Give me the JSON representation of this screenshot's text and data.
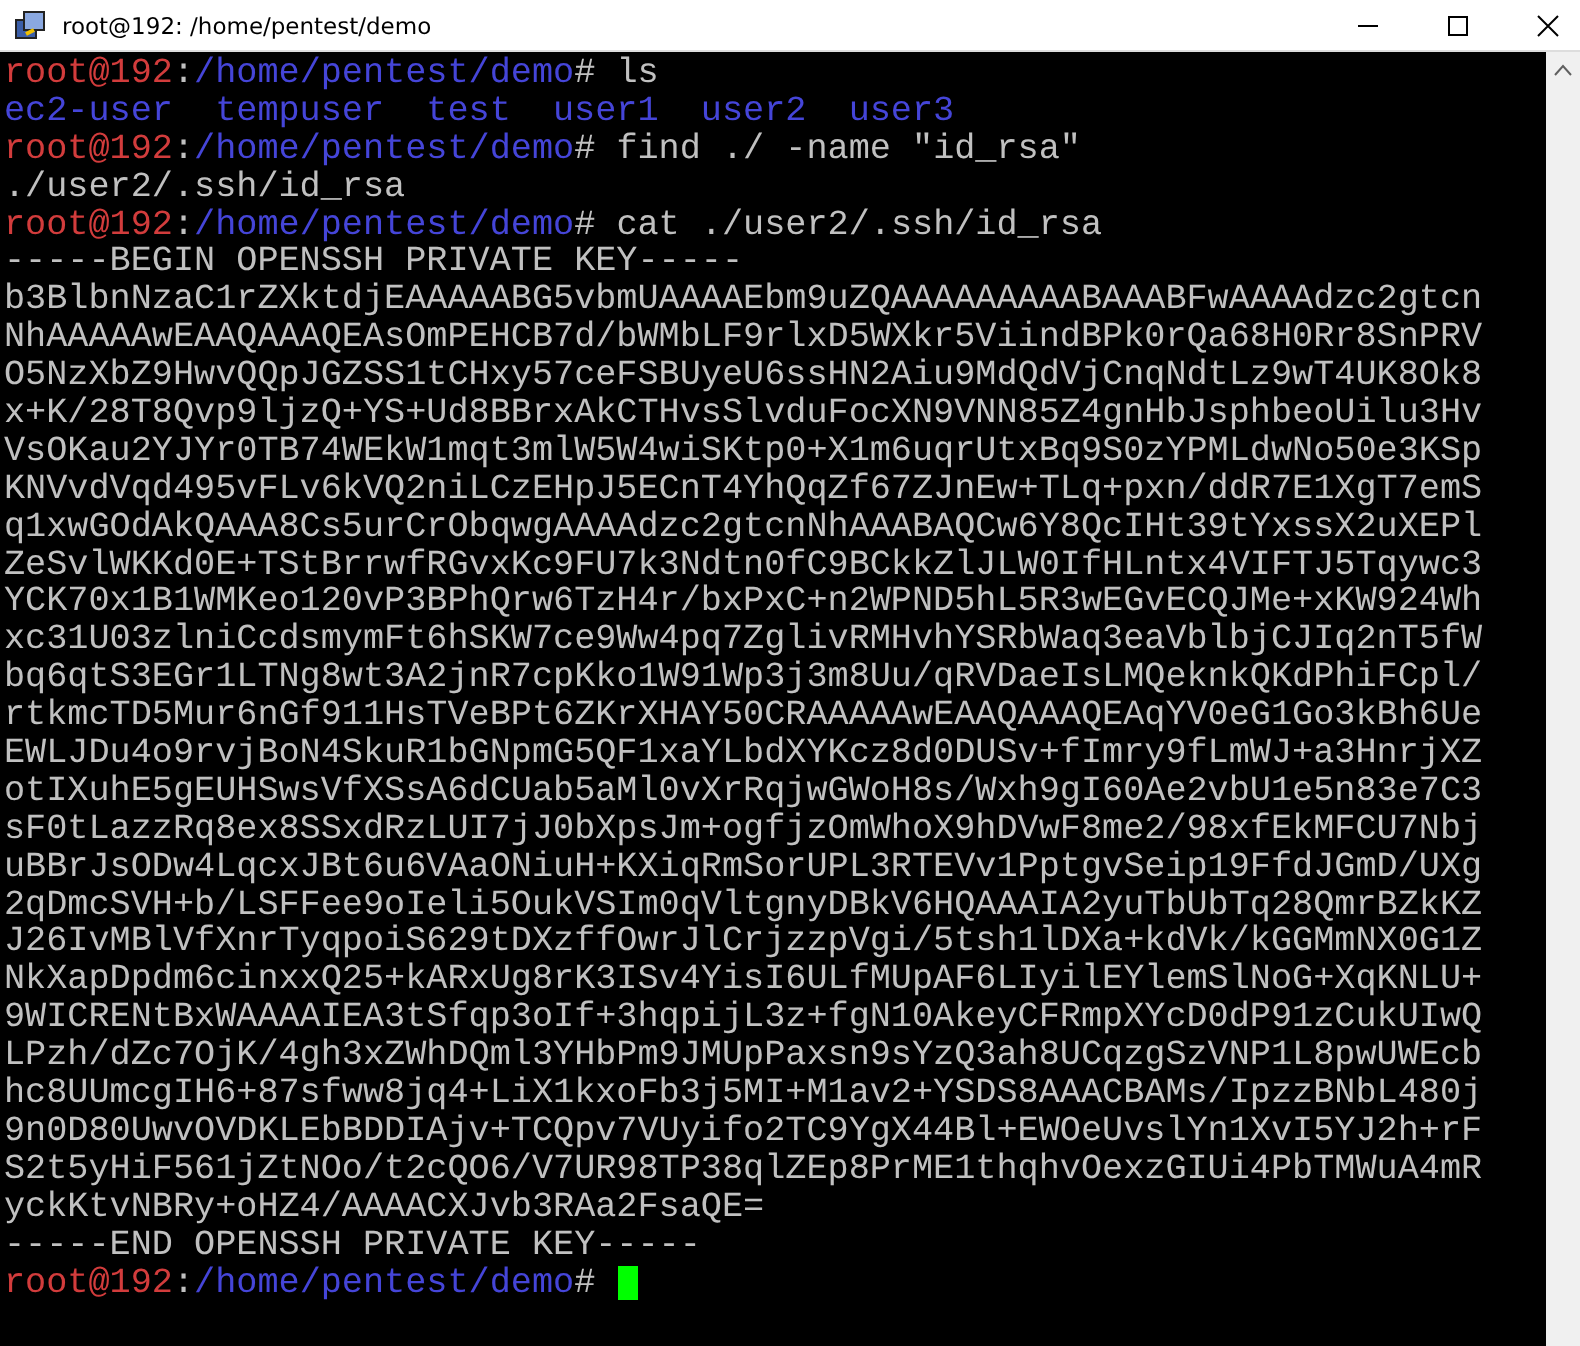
{
  "window": {
    "title": "root@192: /home/pentest/demo"
  },
  "terminal": {
    "lines": [
      {
        "kind": "prompt",
        "user": "root@192",
        "separator": ":",
        "path": "/home/pentest/demo",
        "command": "# ls",
        "cursor": false
      },
      {
        "kind": "listing",
        "items": [
          "ec2-user",
          "tempuser",
          "test",
          "user1",
          "user2",
          "user3"
        ]
      },
      {
        "kind": "prompt",
        "user": "root@192",
        "separator": ":",
        "path": "/home/pentest/demo",
        "command": "# find ./ -name \"id_rsa\"",
        "cursor": false
      },
      {
        "kind": "output",
        "text": "./user2/.ssh/id_rsa"
      },
      {
        "kind": "prompt",
        "user": "root@192",
        "separator": ":",
        "path": "/home/pentest/demo",
        "command": "# cat ./user2/.ssh/id_rsa",
        "cursor": false
      },
      {
        "kind": "output",
        "text": "-----BEGIN OPENSSH PRIVATE KEY-----"
      },
      {
        "kind": "output",
        "text": "b3BlbnNzaC1rZXktdjEAAAAABG5vbmUAAAAEbm9uZQAAAAAAAAABAAABFwAAAAdzc2gtcn"
      },
      {
        "kind": "output",
        "text": "NhAAAAAwEAAQAAAQEAsOmPEHCB7d/bWMbLF9rlxD5WXkr5ViindBPk0rQa68H0Rr8SnPRV"
      },
      {
        "kind": "output",
        "text": "O5NzXbZ9HwvQQpJGZSS1tCHxy57ceFSBUyeU6ssHN2Aiu9MdQdVjCnqNdtLz9wT4UK8Ok8"
      },
      {
        "kind": "output",
        "text": "x+K/28T8Qvp9ljzQ+YS+Ud8BBrxAkCTHvsSlvduFocXN9VNN85Z4gnHbJsphbeoUilu3Hv"
      },
      {
        "kind": "output",
        "text": "VsOKau2YJYr0TB74WEkW1mqt3mlW5W4wiSKtp0+X1m6uqrUtxBq9S0zYPMLdwNo50e3KSp"
      },
      {
        "kind": "output",
        "text": "KNVvdVqd495vFLv6kVQ2niLCzEHpJ5ECnT4YhQqZf67ZJnEw+TLq+pxn/ddR7E1XgT7emS"
      },
      {
        "kind": "output",
        "text": "q1xwGOdAkQAAA8Cs5urCrObqwgAAAAdzc2gtcnNhAAABAQCw6Y8QcIHt39tYxssX2uXEPl"
      },
      {
        "kind": "output",
        "text": "ZeSvlWKKd0E+TStBrrwfRGvxKc9FU7k3Ndtn0fC9BCkkZlJLW0IfHLntx4VIFTJ5Tqywc3"
      },
      {
        "kind": "output",
        "text": "YCK70x1B1WMKeo120vP3BPhQrw6TzH4r/bxPxC+n2WPND5hL5R3wEGvECQJMe+xKW924Wh"
      },
      {
        "kind": "output",
        "text": "xc31U03zlniCcdsmymFt6hSKW7ce9Ww4pq7ZglivRMHvhYSRbWaq3eaVblbjCJIq2nT5fW"
      },
      {
        "kind": "output",
        "text": "bq6qtS3EGr1LTNg8wt3A2jnR7cpKko1W91Wp3j3m8Uu/qRVDaeIsLMQeknkQKdPhiFCpl/"
      },
      {
        "kind": "output",
        "text": "rtkmcTD5Mur6nGf911HsTVeBPt6ZKrXHAY50CRAAAAAwEAAQAAAQEAqYV0eG1Go3kBh6Ue"
      },
      {
        "kind": "output",
        "text": "EWLJDu4o9rvjBoN4SkuR1bGNpmG5QF1xaYLbdXYKcz8d0DUSv+fImry9fLmWJ+a3HnrjXZ"
      },
      {
        "kind": "output",
        "text": "otIXuhE5gEUHSwsVfXSsA6dCUab5aMl0vXrRqjwGWoH8s/Wxh9gI60Ae2vbU1e5n83e7C3"
      },
      {
        "kind": "output",
        "text": "sF0tLazzRq8ex8SSxdRzLUI7jJ0bXpsJm+ogfjzOmWhoX9hDVwF8me2/98xfEkMFCU7Nbj"
      },
      {
        "kind": "output",
        "text": "uBBrJsODw4LqcxJBt6u6VAaONiuH+KXiqRmSorUPL3RTEVv1PptgvSeip19FfdJGmD/UXg"
      },
      {
        "kind": "output",
        "text": "2qDmcSVH+b/LSFFee9oIeli5OukVSIm0qVltgnyDBkV6HQAAAIA2yuTbUbTq28QmrBZkKZ"
      },
      {
        "kind": "output",
        "text": "J26IvMBlVfXnrTyqpoiS629tDXzffOwrJlCrjzzpVgi/5tsh1lDXa+kdVk/kGGMmNX0G1Z"
      },
      {
        "kind": "output",
        "text": "NkXapDpdm6cinxxQ25+kARxUg8rK3ISv4YisI6ULfMUpAF6LIyilEYlemSlNoG+XqKNLU+"
      },
      {
        "kind": "output",
        "text": "9WICRENtBxWAAAAIEA3tSfqp3oIf+3hqpijL3z+fgN10AkeyCFRmpXYcD0dP91zCukUIwQ"
      },
      {
        "kind": "output",
        "text": "LPzh/dZc7OjK/4gh3xZWhDQml3YHbPm9JMUpPaxsn9sYzQ3ah8UCqzgSzVNP1L8pwUWEcb"
      },
      {
        "kind": "output",
        "text": "hc8UUmcgIH6+87sfww8jq4+LiX1kxoFb3j5MI+M1av2+YSDS8AAACBAMs/IpzzBNbL480j"
      },
      {
        "kind": "output",
        "text": "9n0D80UwvOVDKLEbBDDIAjv+TCQpv7VUyifo2TC9YgX44Bl+EWOeUvslYn1XvI5YJ2h+rF"
      },
      {
        "kind": "output",
        "text": "S2t5yHiF561jZtNOo/t2cQO6/V7UR98TP38qlZEp8PrME1thqhvOexzGIUi4PbTMWuA4mR"
      },
      {
        "kind": "output",
        "text": "yckKtvNBRy+oHZ4/AAAACXJvb3RAa2FsaQE="
      },
      {
        "kind": "output",
        "text": "-----END OPENSSH PRIVATE KEY-----"
      },
      {
        "kind": "prompt",
        "user": "root@192",
        "separator": ":",
        "path": "/home/pentest/demo",
        "command": "#",
        "cursor": true
      }
    ]
  }
}
